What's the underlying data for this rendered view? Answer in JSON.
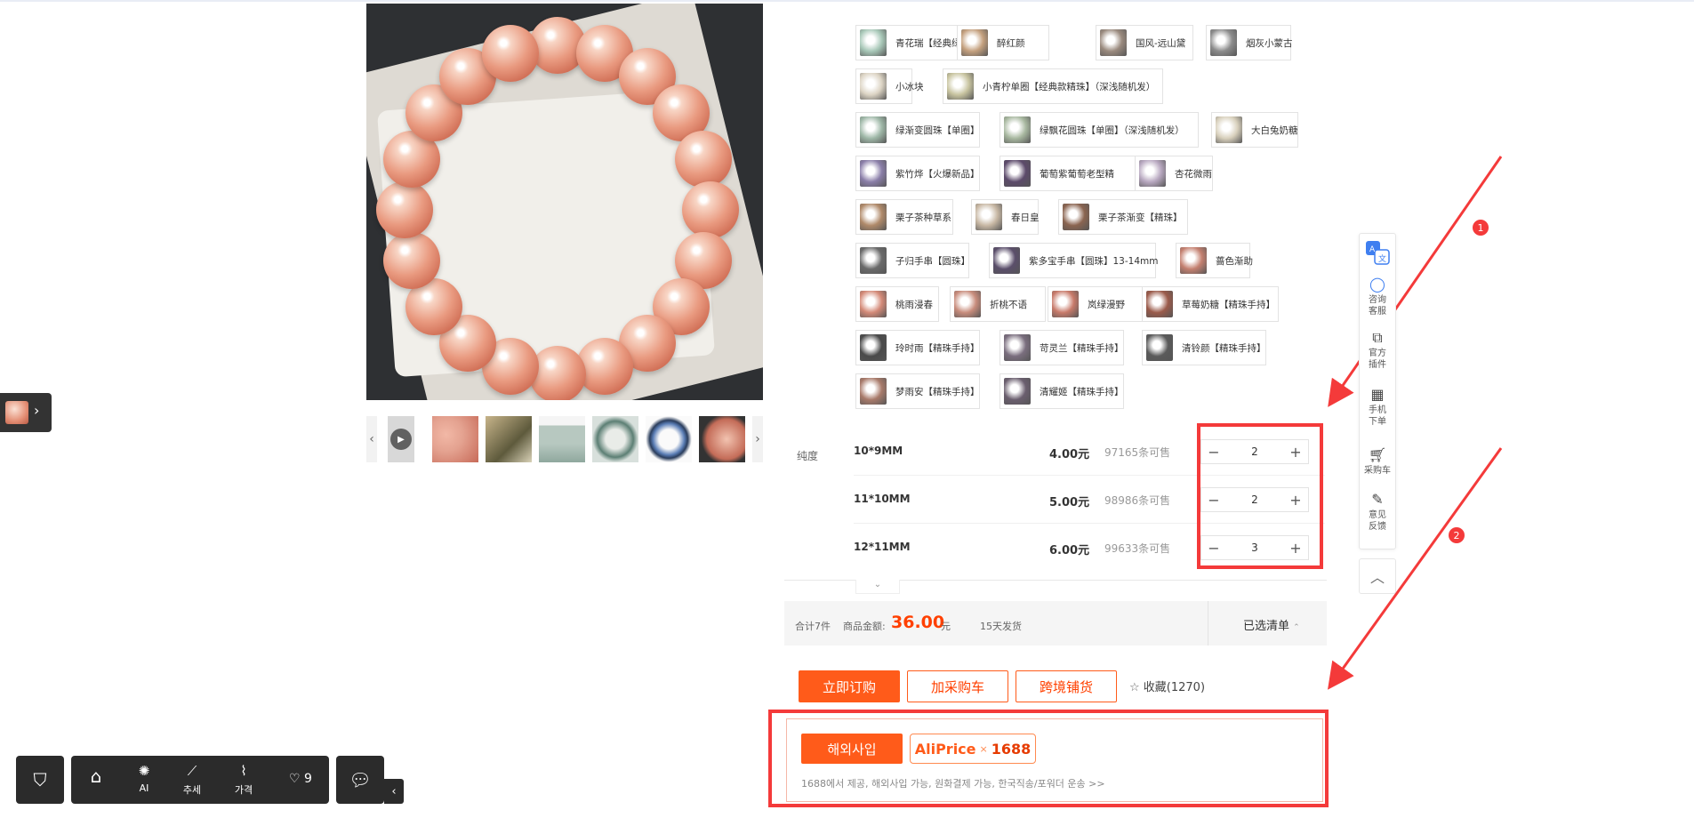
{
  "options": [
    {
      "label": "青花瑞【经典绿飘花】",
      "swatch": "#a8c8b8"
    },
    {
      "label": "醉红颜",
      "swatch": "#c4a07e"
    },
    {
      "label": "国风-远山黛",
      "swatch": "#9a8a7e"
    },
    {
      "label": "烟灰小蒙古",
      "swatch": "#8c8c8c"
    },
    {
      "label": "小冰块",
      "swatch": "#dcd4c4"
    },
    {
      "label": "小青柠单圈【经典款精珠】（深浅随机发）",
      "swatch": "#c8c4a0"
    },
    {
      "label": "绿渐变圆珠【单圈】",
      "swatch": "#9fb8a8"
    },
    {
      "label": "绿飘花圆珠【单圈】（深浅随机发）",
      "swatch": "#a8b8a0"
    },
    {
      "label": "大白兔奶糖",
      "swatch": "#d8d0bc"
    },
    {
      "label": "紫竹烨【火爆新品】",
      "swatch": "#8a7ea8"
    },
    {
      "label": "葡萄紫葡萄老型精",
      "swatch": "#5c4a6a"
    },
    {
      "label": "杏花微雨",
      "swatch": "#b8a8c0"
    },
    {
      "label": "栗子茶种草系",
      "swatch": "#b08a6a"
    },
    {
      "label": "春日皇",
      "swatch": "#c8b8a4"
    },
    {
      "label": "栗子茶渐变【精珠】",
      "swatch": "#8a6450"
    },
    {
      "label": "子归手串【圆珠】",
      "swatch": "#6a6a6a"
    },
    {
      "label": "紫多宝手串【圆珠】13-14mm",
      "swatch": "#5a4e6a"
    },
    {
      "label": "蔷色渐助",
      "swatch": "#c48070"
    },
    {
      "label": "桃雨浸春",
      "swatch": "#d48a78"
    },
    {
      "label": "折桃不语",
      "swatch": "#c88c7c"
    },
    {
      "label": "岚绿漫野",
      "swatch": "#c87a6a"
    },
    {
      "label": "草莓奶糖【精珠手持】",
      "swatch": "#9a5a4a"
    },
    {
      "label": "玲时雨【精珠手持】",
      "swatch": "#4a4a4a"
    },
    {
      "label": "苛灵兰【精珠手持】",
      "swatch": "#7a6e7e"
    },
    {
      "label": "清铃颜【精珠手持】",
      "swatch": "#5a5a5a"
    },
    {
      "label": "梦雨安【精珠手持】",
      "swatch": "#a87a6a"
    },
    {
      "label": "清耀姬【精珠手持】",
      "swatch": "#6a5e6e"
    }
  ],
  "spec": {
    "label": "纯度",
    "rows": [
      {
        "name": "10*9MM",
        "price": "4.00元",
        "stock": "97165条可售",
        "qty": "2"
      },
      {
        "name": "11*10MM",
        "price": "5.00元",
        "stock": "98986条可售",
        "qty": "2"
      },
      {
        "name": "12*11MM",
        "price": "6.00元",
        "stock": "99633条可售",
        "qty": "3"
      }
    ],
    "minus": "−",
    "plus": "+"
  },
  "summary": {
    "total_count": "合计7件",
    "amount_label": "商品金额:",
    "amount": "36.00",
    "currency": "元",
    "ship": "15天发货",
    "selected": "已选清单"
  },
  "actions": {
    "buy_now": "立即订购",
    "add_cart": "加采购车",
    "cross_border": "跨境铺货",
    "favorite": "收藏(1270)"
  },
  "aliprice": {
    "button": "해외사입",
    "brand_a": "AliPrice",
    "brand_x": "×",
    "brand_n": "1688",
    "note": "1688에서 제공, 해외사입 가능, 원화결제 가능, 한국직송/포워더 운송 >>"
  },
  "sidebar": {
    "items": [
      "咨询客服",
      "官方插件",
      "手机下单",
      "采购车",
      "意见反馈"
    ]
  },
  "toolbar": {
    "ai": "AI",
    "trend": "추세",
    "price": "가격",
    "fav_count": "9"
  },
  "annotations": [
    "1",
    "2"
  ],
  "colors": {
    "accent": "#ff5b1a",
    "price": "#ff4000",
    "annotation": "#f43a3a"
  }
}
